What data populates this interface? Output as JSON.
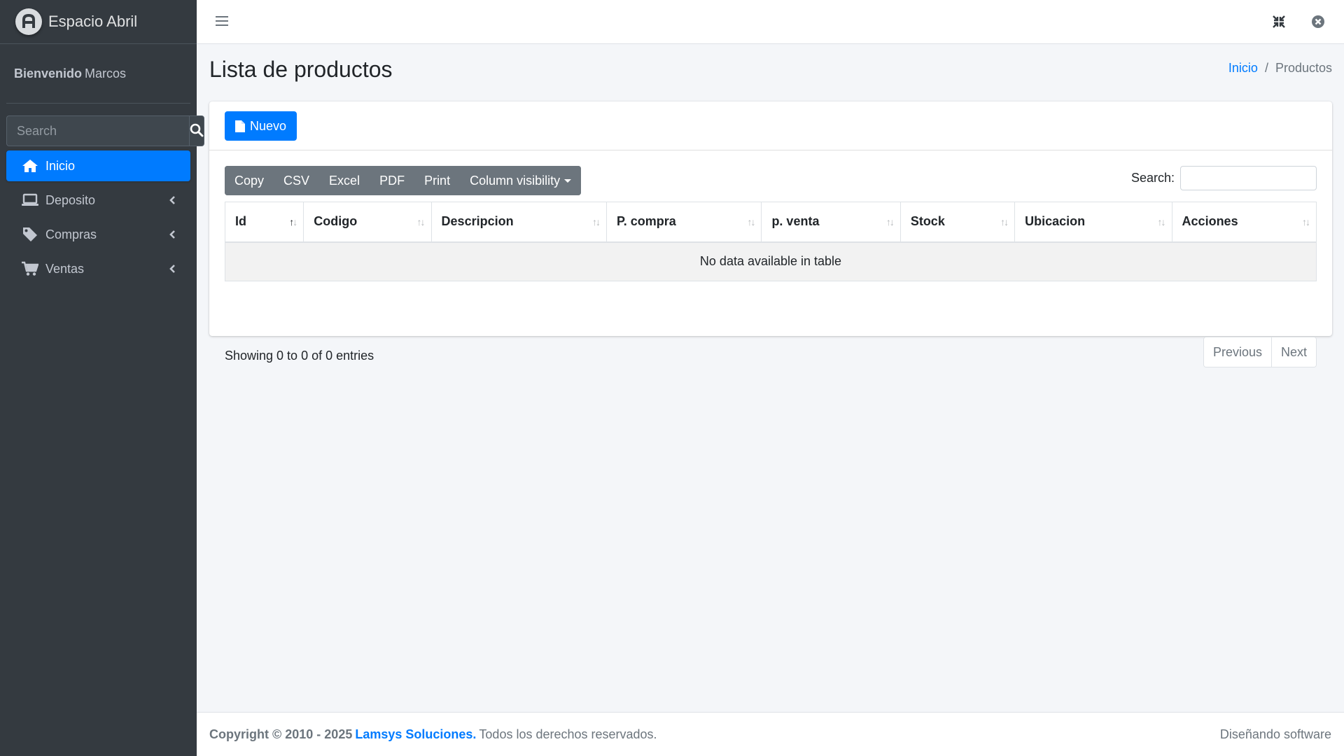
{
  "brand": {
    "name": "Espacio Abril",
    "logo_icon": "brand-logo-icon"
  },
  "user": {
    "welcome": "Bienvenido",
    "name": "Marcos"
  },
  "sidebar": {
    "search_placeholder": "Search",
    "items": [
      {
        "label": "Inicio",
        "icon": "home-icon",
        "active": true
      },
      {
        "label": "Deposito",
        "icon": "laptop-icon",
        "active": false
      },
      {
        "label": "Compras",
        "icon": "tag-icon",
        "active": false
      },
      {
        "label": "Ventas",
        "icon": "cart-icon",
        "active": false
      }
    ]
  },
  "header": {
    "title": "Lista de productos",
    "breadcrumb": {
      "home": "Inicio",
      "separator": "/",
      "current": "Productos"
    }
  },
  "card": {
    "new_button": "Nuevo",
    "export_buttons": [
      "Copy",
      "CSV",
      "Excel",
      "PDF",
      "Print"
    ],
    "column_visibility": "Column visibility",
    "search_label": "Search:",
    "search_value": "",
    "columns": [
      "Id",
      "Codigo",
      "Descripcion",
      "P. compra",
      "p. venta",
      "Stock",
      "Ubicacion",
      "Acciones"
    ],
    "empty_message": "No data available in table",
    "info": "Showing 0 to 0 of 0 entries",
    "pagination": {
      "previous": "Previous",
      "next": "Next"
    }
  },
  "footer": {
    "copyright": "Copyright © 2010 - 2025",
    "company": "Lamsys Soluciones.",
    "rights": "Todos los derechos reservados.",
    "right_text": "Diseñando software"
  },
  "colors": {
    "primary": "#007bff",
    "sidebar_bg": "#343a40",
    "secondary": "#6c757d"
  }
}
